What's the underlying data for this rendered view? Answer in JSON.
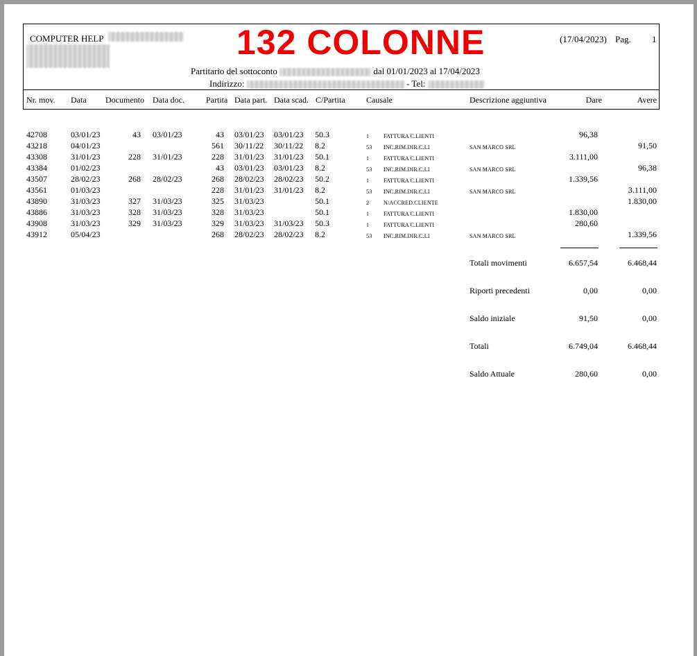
{
  "header": {
    "company": "COMPUTER HELP",
    "banner": "132 COLONNE",
    "date": "(17/04/2023)",
    "page_label": "Pag.",
    "page_number": "1",
    "subtitle_prefix": "Partitario del sottoconto",
    "subtitle_suffix": "dal 01/01/2023 al 17/04/2023",
    "address_label": "Indirizzo:",
    "phone_label": "- Tel:"
  },
  "columns": {
    "nr_mov": "Nr. mov.",
    "data": "Data",
    "documento": "Documento",
    "data_doc": "Data doc.",
    "partita": "Partita",
    "data_part": "Data part.",
    "data_scad": "Data scad.",
    "c_partita": "C/Partita",
    "causale": "Causale",
    "descrizione": "Descrizione aggiuntiva",
    "dare": "Dare",
    "avere": "Avere"
  },
  "rows": [
    {
      "nr": "42708",
      "data": "03/01/23",
      "doc": "43",
      "data_doc": "03/01/23",
      "partita": "43",
      "data_part": "03/01/23",
      "data_scad": "03/01/23",
      "cpart": "50.3",
      "caus_code": "1",
      "caus_desc": "FATTURA C.LIENTI",
      "descr": "",
      "dare": "96,38",
      "avere": ""
    },
    {
      "nr": "43218",
      "data": "04/01/23",
      "doc": "",
      "data_doc": "",
      "partita": "561",
      "data_part": "30/11/22",
      "data_scad": "30/11/22",
      "cpart": "8.2",
      "caus_code": "53",
      "caus_desc": "INC.RIM.DIR.C.LI",
      "descr": "SAN MARCO SRL",
      "dare": "",
      "avere": "91,50"
    },
    {
      "nr": "43308",
      "data": "31/01/23",
      "doc": "228",
      "data_doc": "31/01/23",
      "partita": "228",
      "data_part": "31/01/23",
      "data_scad": "31/01/23",
      "cpart": "50.1",
      "caus_code": "1",
      "caus_desc": "FATTURA C.LIENTI",
      "descr": "",
      "dare": "3.111,00",
      "avere": ""
    },
    {
      "nr": "43384",
      "data": "01/02/23",
      "doc": "",
      "data_doc": "",
      "partita": "43",
      "data_part": "03/01/23",
      "data_scad": "03/01/23",
      "cpart": "8.2",
      "caus_code": "53",
      "caus_desc": "INC.RIM.DIR.C.LI",
      "descr": "SAN MARCO SRL",
      "dare": "",
      "avere": "96,38"
    },
    {
      "nr": "43507",
      "data": "28/02/23",
      "doc": "268",
      "data_doc": "28/02/23",
      "partita": "268",
      "data_part": "28/02/23",
      "data_scad": "28/02/23",
      "cpart": "50.2",
      "caus_code": "1",
      "caus_desc": "FATTURA C.LIENTI",
      "descr": "",
      "dare": "1.339,56",
      "avere": ""
    },
    {
      "nr": "43561",
      "data": "01/03/23",
      "doc": "",
      "data_doc": "",
      "partita": "228",
      "data_part": "31/01/23",
      "data_scad": "31/01/23",
      "cpart": "8.2",
      "caus_code": "53",
      "caus_desc": "INC.RIM.DIR.C.LI",
      "descr": "SAN MARCO SRL",
      "dare": "",
      "avere": "3.111,00"
    },
    {
      "nr": "43890",
      "data": "31/03/23",
      "doc": "327",
      "data_doc": "31/03/23",
      "partita": "325",
      "data_part": "31/03/23",
      "data_scad": "",
      "cpart": "50.1",
      "caus_code": "2",
      "caus_desc": "N/ACCRED.CLIENTE",
      "descr": "",
      "dare": "",
      "avere": "1.830,00"
    },
    {
      "nr": "43886",
      "data": "31/03/23",
      "doc": "328",
      "data_doc": "31/03/23",
      "partita": "328",
      "data_part": "31/03/23",
      "data_scad": "",
      "cpart": "50.1",
      "caus_code": "1",
      "caus_desc": "FATTURA C.LIENTI",
      "descr": "",
      "dare": "1.830,00",
      "avere": ""
    },
    {
      "nr": "43908",
      "data": "31/03/23",
      "doc": "329",
      "data_doc": "31/03/23",
      "partita": "329",
      "data_part": "31/03/23",
      "data_scad": "31/03/23",
      "cpart": "50.3",
      "caus_code": "1",
      "caus_desc": "FATTURA C.LIENTI",
      "descr": "",
      "dare": "280,60",
      "avere": ""
    },
    {
      "nr": "43912",
      "data": "05/04/23",
      "doc": "",
      "data_doc": "",
      "partita": "268",
      "data_part": "28/02/23",
      "data_scad": "28/02/23",
      "cpart": "8.2",
      "caus_code": "53",
      "caus_desc": "INC.RIM.DIR.C.LI",
      "descr": "SAN MARCO SRL",
      "dare": "",
      "avere": "1.339,56"
    }
  ],
  "totals": [
    {
      "label": "Totali movimenti",
      "dare": "6.657,54",
      "avere": "6.468,44"
    },
    {
      "label": "Riporti precedenti",
      "dare": "0,00",
      "avere": "0,00"
    },
    {
      "label": "Saldo iniziale",
      "dare": "91,50",
      "avere": "0,00"
    },
    {
      "label": "Totali",
      "dare": "6.749,04",
      "avere": "6.468,44"
    },
    {
      "label": "Saldo Attuale",
      "dare": "280,60",
      "avere": "0,00"
    }
  ]
}
